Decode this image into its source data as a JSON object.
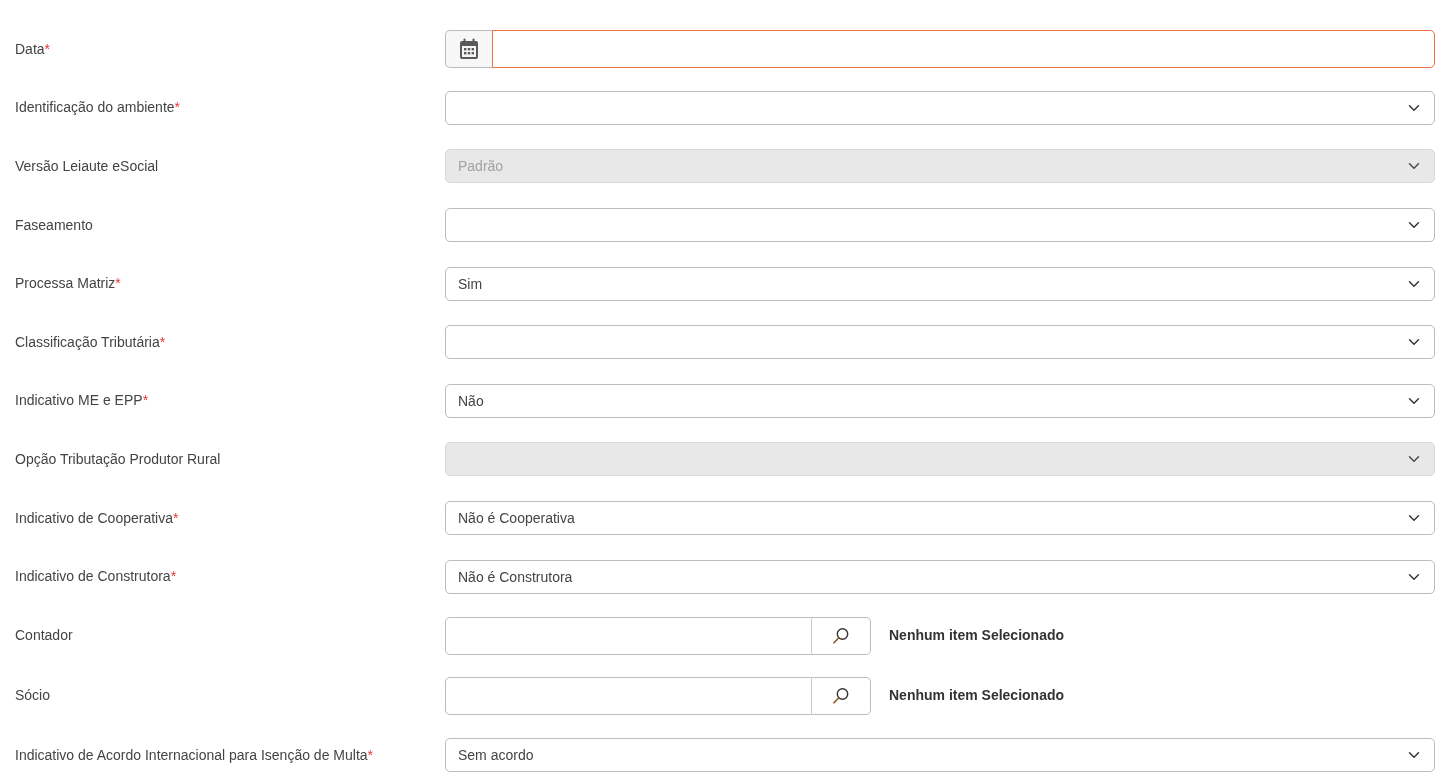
{
  "fields": [
    {
      "kind": "date",
      "label": "Data",
      "mark": "*",
      "disabled": false,
      "error": true
    },
    {
      "kind": "select",
      "label": "Identificação do ambiente",
      "mark": "*",
      "disabled": false,
      "error": false
    },
    {
      "kind": "select",
      "label": "Versão Leiaute eSocial",
      "value": "Padrão",
      "disabled": true,
      "error": false
    },
    {
      "kind": "select",
      "label": "Faseamento",
      "disabled": false,
      "error": false
    },
    {
      "kind": "select",
      "label": "Processa Matriz",
      "mark": "*",
      "value": "Sim",
      "disabled": false,
      "error": false
    },
    {
      "kind": "select",
      "label": "Classificação Tributária",
      "mark": "*",
      "disabled": false,
      "error": false
    },
    {
      "kind": "select",
      "label": "Indicativo ME e EPP",
      "mark": "*",
      "value": "Não",
      "disabled": false,
      "error": false
    },
    {
      "kind": "select",
      "label": "Opção Tributação Produtor Rural",
      "disabled": true,
      "error": false
    },
    {
      "kind": "select",
      "label": "Indicativo de Cooperativa",
      "mark": "*",
      "value": "Não é Cooperativa",
      "disabled": false,
      "error": false
    },
    {
      "kind": "select",
      "label": "Indicativo de Construtora",
      "mark": "*",
      "value": "Não é Construtora",
      "disabled": false,
      "error": false
    },
    {
      "kind": "lookup",
      "label": "Contador",
      "selection": "Nenhum item Selecionado",
      "disabled": false,
      "error": false
    },
    {
      "kind": "lookup",
      "label": "Sócio",
      "selection": "Nenhum item Selecionado",
      "disabled": false,
      "error": false
    },
    {
      "kind": "select",
      "label": "Indicativo de Acordo Internacional para Isenção de Multa",
      "mark": "*",
      "value": "Sem acordo",
      "disabled": false,
      "error": false
    }
  ]
}
